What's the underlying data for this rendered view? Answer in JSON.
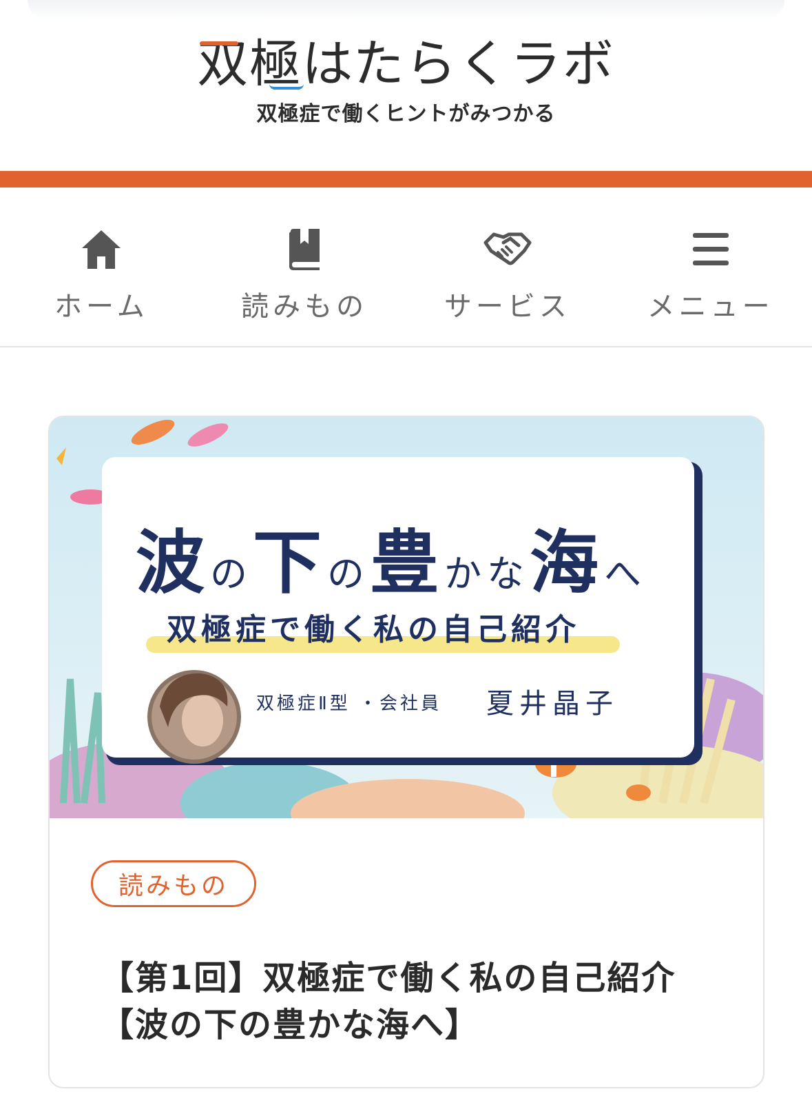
{
  "header": {
    "logo_main": "双極はたらくラボ",
    "logo_sub": "双極症で働くヒントがみつかる"
  },
  "colors": {
    "accent": "#e0632f",
    "navy": "#1f2f5f",
    "logo_blue": "#2f8fd8"
  },
  "nav": {
    "items": [
      {
        "label": "ホーム",
        "icon": "home-icon"
      },
      {
        "label": "読みもの",
        "icon": "book-icon"
      },
      {
        "label": "サービス",
        "icon": "handshake-icon"
      },
      {
        "label": "メニュー",
        "icon": "hamburger-icon"
      }
    ]
  },
  "article": {
    "hero": {
      "title_parts": [
        "波",
        "の",
        "下",
        "の",
        "豊",
        "か",
        "な",
        "海",
        "へ"
      ],
      "subtitle": "双極症で働く私の自己紹介",
      "profile": "双極症Ⅱ型 ・会社員",
      "author": "夏井晶子"
    },
    "tag": "読みもの",
    "title": "【第1回】双極症で働く私の自己紹介【波の下の豊かな海へ】"
  }
}
